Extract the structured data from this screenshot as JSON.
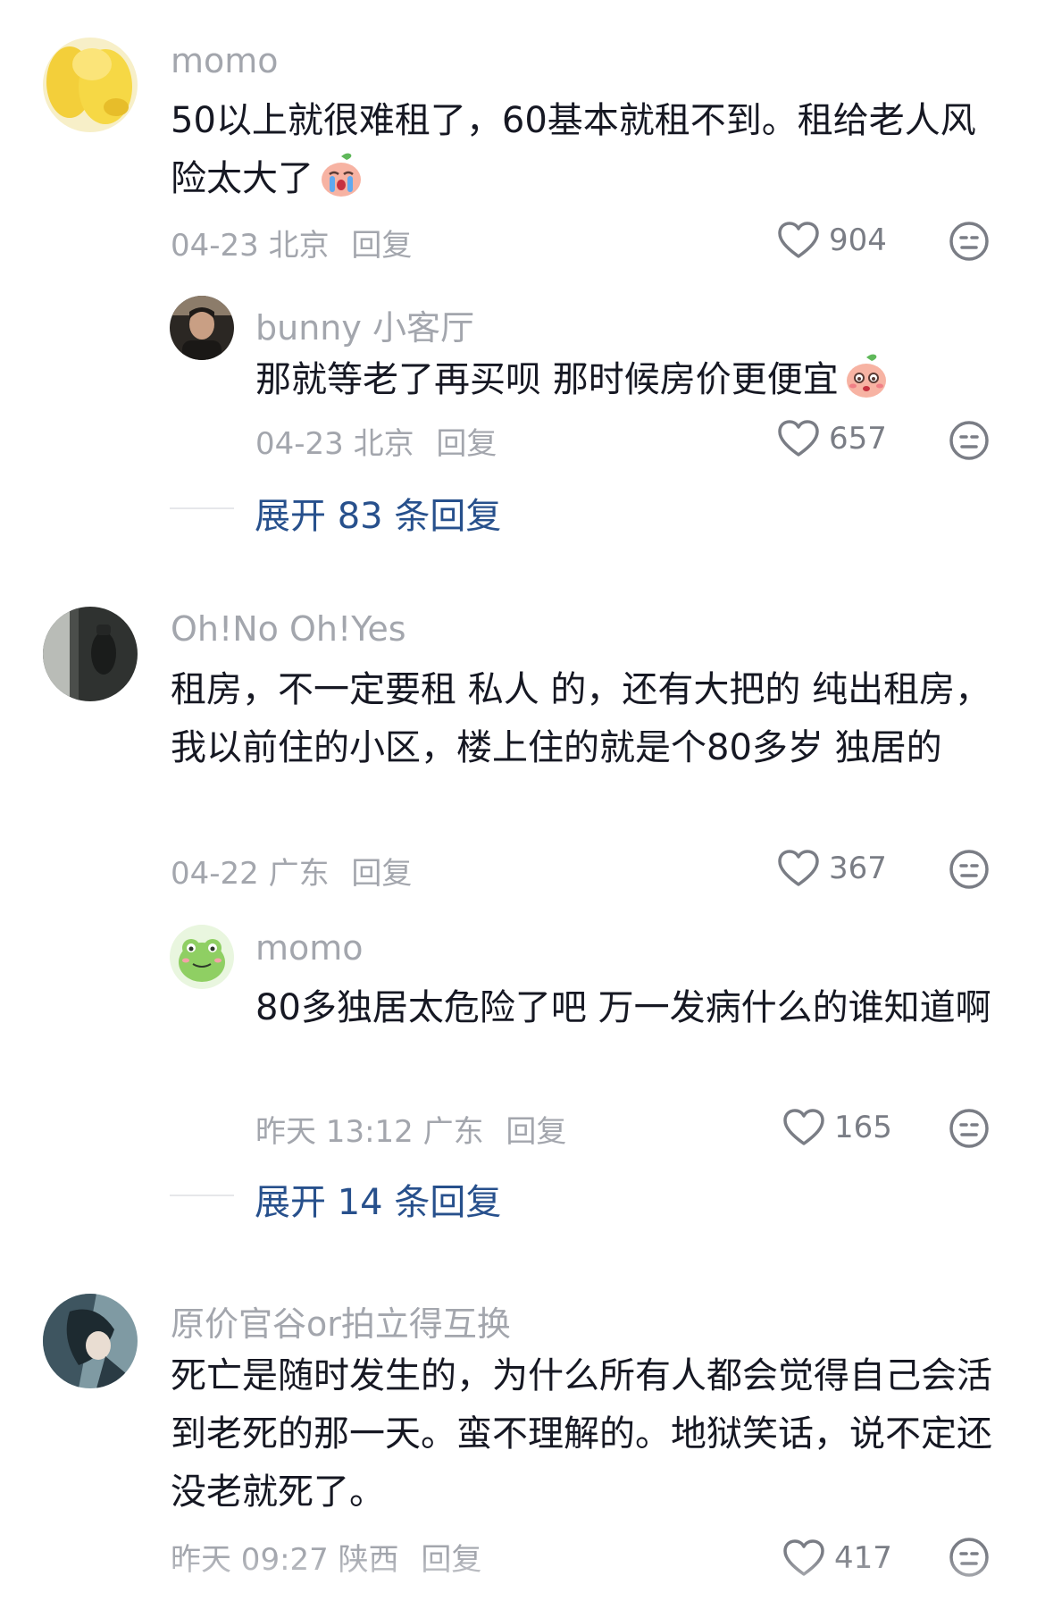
{
  "comments": [
    {
      "username": "momo",
      "text": "50以上就很难租了，60基本就租不到。租给老人风险太大了",
      "emoji": "crying-peach-emoji",
      "date": "04-23",
      "location": "北京",
      "reply_label": "回复",
      "likes": "904",
      "replies": [
        {
          "username": "bunny 小客厅",
          "text": "那就等老了再买呗 那时候房价更便宜",
          "emoji": "shy-peach-emoji",
          "date": "04-23",
          "location": "北京",
          "reply_label": "回复",
          "likes": "657"
        }
      ],
      "expand_label": "展开 83 条回复"
    },
    {
      "username": "Oh!No Oh!Yes",
      "text": "租房，不一定要租 私人 的，还有大把的 纯出租房，我以前住的小区，楼上住的就是个80多岁 独居的",
      "date": "04-22",
      "location": "广东",
      "reply_label": "回复",
      "likes": "367",
      "replies": [
        {
          "username": "momo",
          "text": "80多独居太危险了吧 万一发病什么的谁知道啊",
          "date": "昨天 13:12",
          "location": "广东",
          "reply_label": "回复",
          "likes": "165"
        }
      ],
      "expand_label": "展开 14 条回复"
    },
    {
      "username": "原价官谷or拍立得互换",
      "text": "死亡是随时发生的，为什么所有人都会觉得自己会活到老死的那一天。蛮不理解的。地狱笑话，说不定还没老就死了。",
      "date": "昨天 09:27",
      "location": "陕西",
      "reply_label": "回复",
      "likes": "417"
    }
  ],
  "colors": {
    "username": "#a3a6ad",
    "text": "#161823",
    "expand_link": "#27508c",
    "icon_gray": "#7a7d85"
  }
}
